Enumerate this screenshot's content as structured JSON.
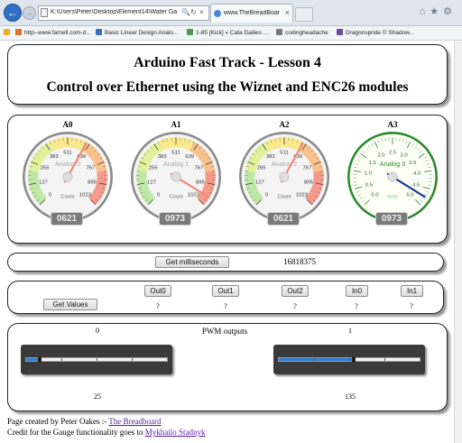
{
  "browser": {
    "url": "K:\\Users\\Peter\\Desktop\\Element14\\Water Gauge\\lesson4.h",
    "tab_title": "www.TheBreadBoard.ca - A...",
    "favorites": [
      {
        "label": "http--www.farnell.com-d...",
        "color": "#e0702a"
      },
      {
        "label": "Basic Linear Design Analo...",
        "color": "#3a6fb8"
      },
      {
        "label": "1-85 [Kick] « Cata Dailies ...",
        "color": "#4a9a4a"
      },
      {
        "label": "codingheadache",
        "color": "#7a7a7a"
      },
      {
        "label": "Dragonspride © Shadow...",
        "color": "#6a4aa0"
      }
    ]
  },
  "header": {
    "line1": "Arduino Fast Track - Lesson 4",
    "line2": "Control over Ethernet using the Wiznet and ENC26 modules"
  },
  "gauges": [
    {
      "label": "A0",
      "name": "Analog 0",
      "unit": "Count",
      "readout": "0621",
      "value": 621,
      "min": 0,
      "max": 1023,
      "ticks": [
        "0",
        "127",
        "255",
        "383",
        "511",
        "639",
        "767",
        "895",
        "1023"
      ],
      "style": "rainbow"
    },
    {
      "label": "A1",
      "name": "Analog 1",
      "unit": "Count",
      "readout": "0973",
      "value": 973,
      "min": 0,
      "max": 1023,
      "ticks": [
        "0",
        "127",
        "255",
        "383",
        "511",
        "639",
        "767",
        "895",
        "1023"
      ],
      "style": "rainbow"
    },
    {
      "label": "A2",
      "name": "Analog 2",
      "unit": "Count",
      "readout": "0621",
      "value": 621,
      "min": 0,
      "max": 1023,
      "ticks": [
        "0",
        "127",
        "255",
        "383",
        "511",
        "639",
        "767",
        "895",
        "1023"
      ],
      "style": "rainbow"
    },
    {
      "label": "A3",
      "name": "Analog 3",
      "unit": "Volts",
      "readout": "0973",
      "value": 4.755,
      "min": 0,
      "max": 5,
      "ticks": [
        "0.0",
        "0.5",
        "1.0",
        "1.5",
        "2.0",
        "2.5",
        "3.0",
        "3.5",
        "4.0",
        "4.5",
        "5.0"
      ],
      "style": "green"
    }
  ],
  "milliseconds": {
    "button_label": "Get milliseconds",
    "value": "16818375"
  },
  "io": {
    "buttons": [
      {
        "label": "Out0",
        "value": "?"
      },
      {
        "label": "Out1",
        "value": "?"
      },
      {
        "label": "Out2",
        "value": "?"
      },
      {
        "label": "In0",
        "value": "?"
      },
      {
        "label": "In1",
        "value": "?"
      }
    ],
    "get_values_label": "Get Values"
  },
  "pwm": {
    "title": "PWM outputs",
    "channels": [
      {
        "channel": "0",
        "value": "25",
        "fraction": 0.098
      },
      {
        "channel": "1",
        "value": "135",
        "fraction": 0.529
      }
    ]
  },
  "credits": {
    "line1_text": "Page created by Peter Oakes :- ",
    "line1_link": "The Breadboard",
    "line2_text": "Credit for the Gauge functionality goes to ",
    "line2_link": "Mykhailo Stadnyk"
  },
  "colors": {
    "gauge_needle": "#f08a7a",
    "volt_needle": "#1a3e8a",
    "volt_ring": "#2a8a2a",
    "slider_fill": "#2b7fd9"
  }
}
